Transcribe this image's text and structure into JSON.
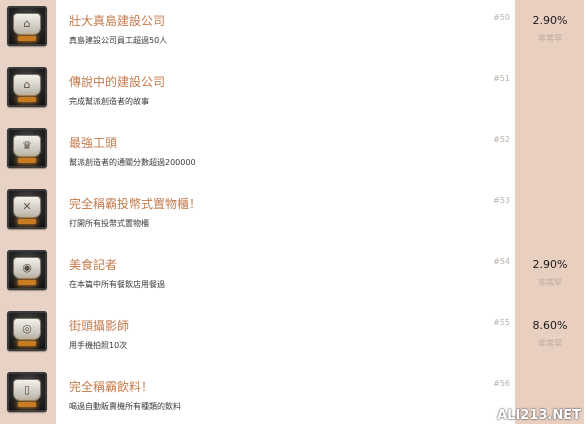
{
  "achievements": [
    {
      "title": "壯大真島建設公司",
      "description": "真島建設公司員工超過50人",
      "number": "#50",
      "percent": "2.90%",
      "rarity_label": "非常罕",
      "icon": "building-icon"
    },
    {
      "title": "傳說中的建設公司",
      "description": "完成幫派創造者的故事",
      "number": "#51",
      "percent": "",
      "rarity_label": "",
      "icon": "building-icon"
    },
    {
      "title": "最強工頭",
      "description": "幫派創造者的通關分數超過200000",
      "number": "#52",
      "percent": "",
      "rarity_label": "",
      "icon": "trophy-icon"
    },
    {
      "title": "完全稱霸投幣式置物櫃！",
      "description": "打開所有投幣式置物櫃",
      "number": "#53",
      "percent": "",
      "rarity_label": "",
      "icon": "key-icon"
    },
    {
      "title": "美食記者",
      "description": "在本篇中所有餐飲店用餐過",
      "number": "#54",
      "percent": "2.90%",
      "rarity_label": "非常罕",
      "icon": "food-icon"
    },
    {
      "title": "街頭攝影師",
      "description": "用手機拍照10次",
      "number": "#55",
      "percent": "8.60%",
      "rarity_label": "非常罕",
      "icon": "camera-icon"
    },
    {
      "title": "完全稱霸飲料！",
      "description": "喝過自動販賣機所有種類的飲料",
      "number": "#56",
      "percent": "",
      "rarity_label": "",
      "icon": "drink-icon"
    }
  ],
  "watermark": "ALI213.NET"
}
